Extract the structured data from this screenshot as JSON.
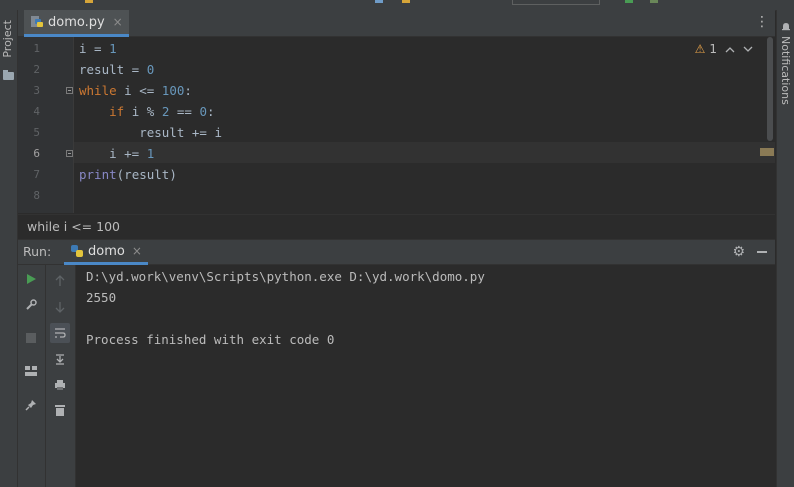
{
  "editor_tab": {
    "filename": "domo.py",
    "close": "×"
  },
  "tab_menu_glyph": "⋮",
  "left_stripe": {
    "project_label": "Project"
  },
  "right_stripe": {
    "notifications_label": "Notifications"
  },
  "inspections": {
    "warning_icon": "⚠",
    "warning_count": "1"
  },
  "gutter": {
    "line_numbers": [
      "1",
      "2",
      "3",
      "4",
      "5",
      "6",
      "7",
      "8"
    ],
    "current_line": "6"
  },
  "code_lines": [
    [
      {
        "t": "i = ",
        "c": "plain"
      },
      {
        "t": "1",
        "c": "num"
      }
    ],
    [
      {
        "t": "result = ",
        "c": "plain"
      },
      {
        "t": "0",
        "c": "num"
      }
    ],
    [
      {
        "t": "while",
        "c": "kw"
      },
      {
        "t": " i <= ",
        "c": "plain"
      },
      {
        "t": "100",
        "c": "num"
      },
      {
        "t": ":",
        "c": "plain"
      }
    ],
    [
      {
        "t": "    ",
        "c": "plain"
      },
      {
        "t": "if",
        "c": "kw"
      },
      {
        "t": " i % ",
        "c": "plain"
      },
      {
        "t": "2",
        "c": "num"
      },
      {
        "t": " == ",
        "c": "plain"
      },
      {
        "t": "0",
        "c": "num"
      },
      {
        "t": ":",
        "c": "plain"
      }
    ],
    [
      {
        "t": "        result += i",
        "c": "plain"
      }
    ],
    [
      {
        "t": "    i += ",
        "c": "plain"
      },
      {
        "t": "1",
        "c": "num"
      }
    ],
    [
      {
        "t": "print",
        "c": "bi"
      },
      {
        "t": "(result)",
        "c": "plain"
      }
    ],
    []
  ],
  "breadcrumb": "while i <= 100",
  "run_panel": {
    "label": "Run:",
    "tab_name": "domo",
    "tab_close": "×",
    "settings_icon": "gear-icon"
  },
  "console_lines": [
    "D:\\yd.work\\venv\\Scripts\\python.exe D:\\yd.work\\domo.py",
    "2550",
    "",
    "Process finished with exit code 0"
  ],
  "colors": {
    "background": "#2b2b2b",
    "panel": "#3c3f41",
    "keyword": "#cc7832",
    "number": "#6897bb",
    "builtin": "#8888c6",
    "text": "#a9b7c6",
    "accent": "#4a88c7",
    "run_green": "#499c54"
  }
}
